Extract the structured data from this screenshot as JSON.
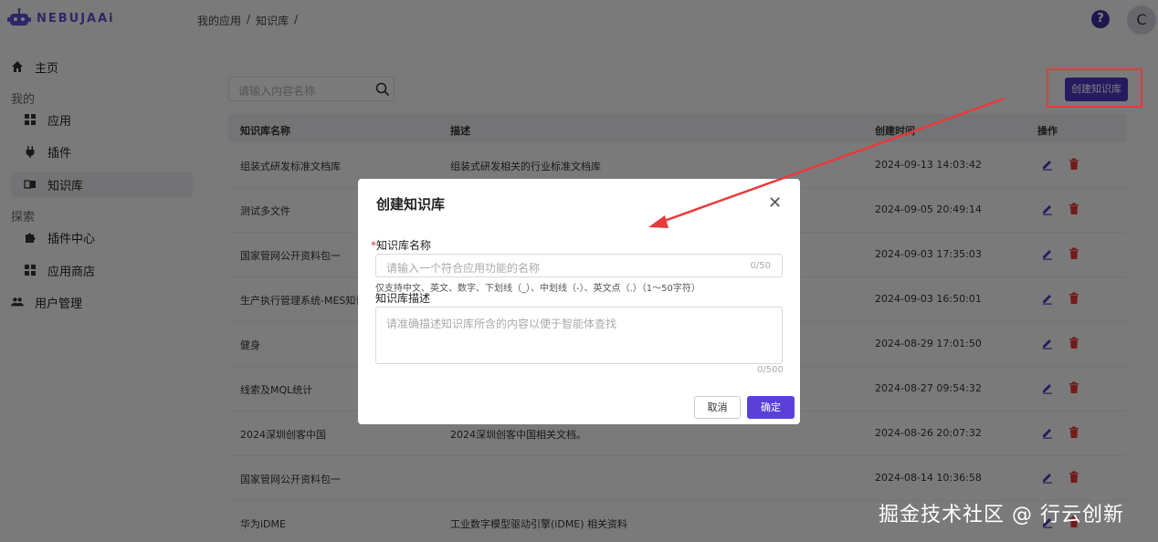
{
  "header": {
    "brand": "NEBUJAAi",
    "breadcrumb": [
      "我的应用",
      "/",
      "知识库",
      "/"
    ],
    "help": "?",
    "avatar": "C"
  },
  "sidebar": {
    "home": "主页",
    "section_mine": "我的",
    "apps": "应用",
    "plugins": "插件",
    "knowledge": "知识库",
    "section_explore": "探索",
    "plugin_center": "插件中心",
    "app_store": "应用商店",
    "user_mgmt": "用户管理"
  },
  "search": {
    "placeholder": "请输入内容名称"
  },
  "create_button": "创建知识库",
  "table": {
    "headers": {
      "name": "知识库名称",
      "desc": "描述",
      "time": "创建时间",
      "ops": "操作"
    },
    "rows": [
      {
        "name": "组装式研发标准文档库",
        "desc": "组装式研发相关的行业标准文档库",
        "time": "2024-09-13 14:03:42"
      },
      {
        "name": "测试多文件",
        "desc": "",
        "time": "2024-09-05 20:49:14"
      },
      {
        "name": "国家管网公开资料包一",
        "desc": "",
        "time": "2024-09-03 17:35:03"
      },
      {
        "name": "生产执行管理系统-MES知识库",
        "desc": "",
        "time": "2024-09-03 16:50:01"
      },
      {
        "name": "健身",
        "desc": "",
        "time": "2024-08-29 17:01:50"
      },
      {
        "name": "线索及MQL统计",
        "desc": "",
        "time": "2024-08-27 09:54:32"
      },
      {
        "name": "2024深圳创客中国",
        "desc": "2024深圳创客中国相关文档。",
        "time": "2024-08-26 20:07:32"
      },
      {
        "name": "国家管网公开资料包一",
        "desc": "",
        "time": "2024-08-14 10:36:58"
      },
      {
        "name": "华为iDME",
        "desc": "工业数字模型驱动引擎(iDME) 相关资料",
        "time": ""
      }
    ]
  },
  "modal": {
    "title": "创建知识库",
    "close": "✕",
    "name_label_req": "*",
    "name_label": "知识库名称",
    "name_placeholder": "请输入一个符合应用功能的名称",
    "name_count": "0/50",
    "name_hint": "仅支持中文、英文、数字、下划线（_）、中划线（-）、英文点（.）（1～50字符）",
    "desc_label": "知识库描述",
    "desc_placeholder": "请准确描述知识库所含的内容以便于智能体查找",
    "desc_count": "0/500",
    "cancel": "取消",
    "confirm": "确定"
  },
  "watermark": "掘金技术社区 @ 行云创新",
  "colors": {
    "accent": "#4a37c2",
    "annotation": "#e83a3a"
  }
}
